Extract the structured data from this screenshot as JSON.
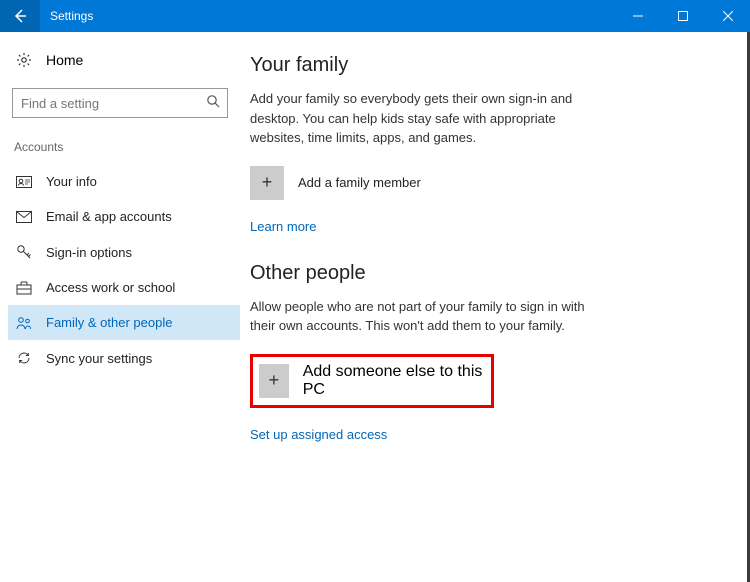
{
  "titlebar": {
    "title": "Settings"
  },
  "sidebar": {
    "home": "Home",
    "searchPlaceholder": "Find a setting",
    "sectionLabel": "Accounts",
    "items": [
      {
        "label": "Your info"
      },
      {
        "label": "Email & app accounts"
      },
      {
        "label": "Sign-in options"
      },
      {
        "label": "Access work or school"
      },
      {
        "label": "Family & other people"
      },
      {
        "label": "Sync your settings"
      }
    ]
  },
  "main": {
    "family": {
      "heading": "Your family",
      "desc": "Add your family so everybody gets their own sign-in and desktop. You can help kids stay safe with appropriate websites, time limits, apps, and games.",
      "addLabel": "Add a family member",
      "learnMore": "Learn more"
    },
    "other": {
      "heading": "Other people",
      "desc": "Allow people who are not part of your family to sign in with their own accounts. This won't add them to your family.",
      "addLabel": "Add someone else to this PC",
      "assigned": "Set up assigned access"
    }
  }
}
